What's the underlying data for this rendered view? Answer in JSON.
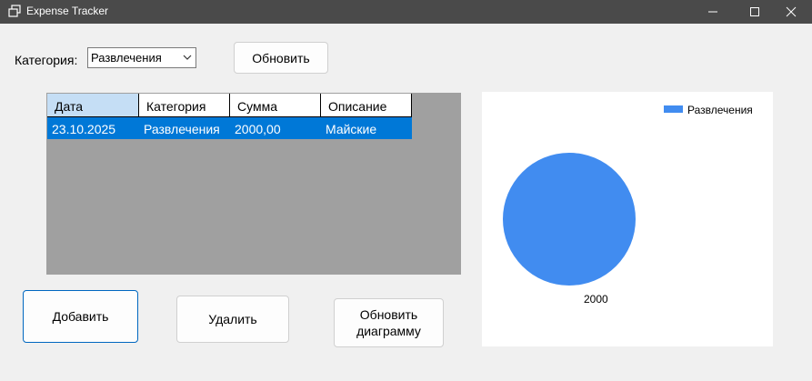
{
  "window": {
    "title": "Expense Tracker",
    "icon": "app-window-icon",
    "controls": [
      "minimize-icon",
      "maximize-icon",
      "close-icon"
    ]
  },
  "filter": {
    "label": "Категория:",
    "selected": "Развлечения",
    "refresh_label": "Обновить"
  },
  "table": {
    "columns": [
      "Дата",
      "Категория",
      "Сумма",
      "Описание"
    ],
    "rows": [
      [
        "23.10.2025",
        "Развлечения",
        "2000,00",
        "Майские"
      ]
    ]
  },
  "actions": {
    "add_label": "Добавить",
    "delete_label": "Удалить",
    "update_chart_label": "Обновить\nдиаграмму"
  },
  "chart_data": {
    "type": "pie",
    "categories": [
      "Развлечения"
    ],
    "values": [
      2000
    ],
    "data_labels": [
      "2000"
    ],
    "legend_position": "top-right",
    "colors": [
      "#418cf0"
    ]
  },
  "colors": {
    "titlebar": "#4a4a4a",
    "selection": "#0078d7",
    "header_selected": "#c5def5",
    "grid_background": "#a0a0a0",
    "pie": "#418cf0"
  }
}
